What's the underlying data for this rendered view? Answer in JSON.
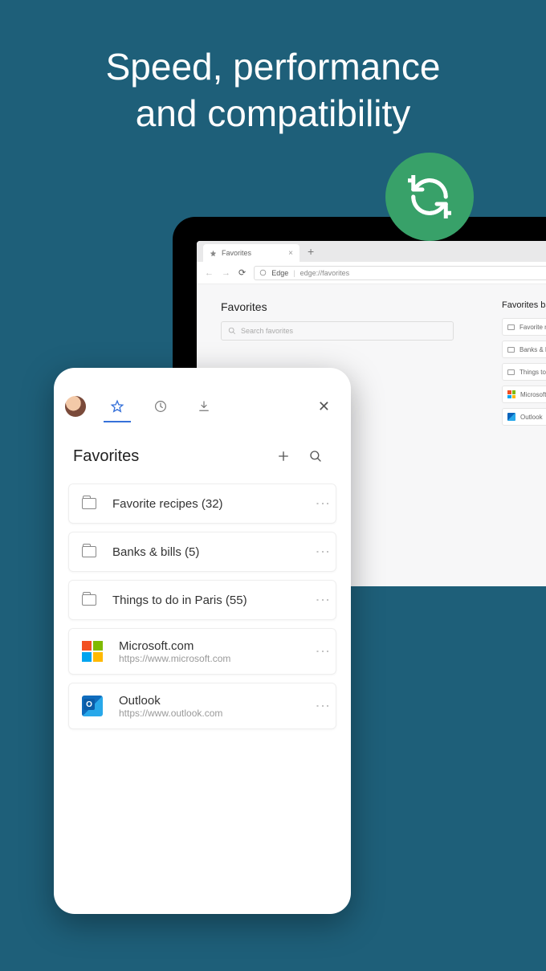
{
  "headline": {
    "line1": "Speed, performance",
    "line2": "and compatibility"
  },
  "laptop": {
    "tab_title": "Favorites",
    "address_scheme": "Edge",
    "address_path": "edge://favorites",
    "page_title": "Favorites",
    "search_placeholder": "Search favorites",
    "sidebar_title": "Favorites bar",
    "sidebar_items": [
      {
        "label": "Favorite recipes",
        "icon": "folder"
      },
      {
        "label": "Banks & bills",
        "icon": "folder"
      },
      {
        "label": "Things to do in Paris",
        "icon": "folder"
      },
      {
        "label": "Microsoft",
        "icon": "microsoft"
      },
      {
        "label": "Outlook",
        "icon": "outlook"
      }
    ]
  },
  "phone": {
    "title": "Favorites",
    "items": [
      {
        "type": "folder",
        "label": "Favorite recipes (32)"
      },
      {
        "type": "folder",
        "label": "Banks & bills (5)"
      },
      {
        "type": "folder",
        "label": "Things to do in Paris (55)"
      },
      {
        "type": "site",
        "title": "Microsoft.com",
        "url": "https://www.microsoft.com",
        "icon": "microsoft"
      },
      {
        "type": "site",
        "title": "Outlook",
        "url": "https://www.outlook.com",
        "icon": "outlook"
      }
    ]
  }
}
